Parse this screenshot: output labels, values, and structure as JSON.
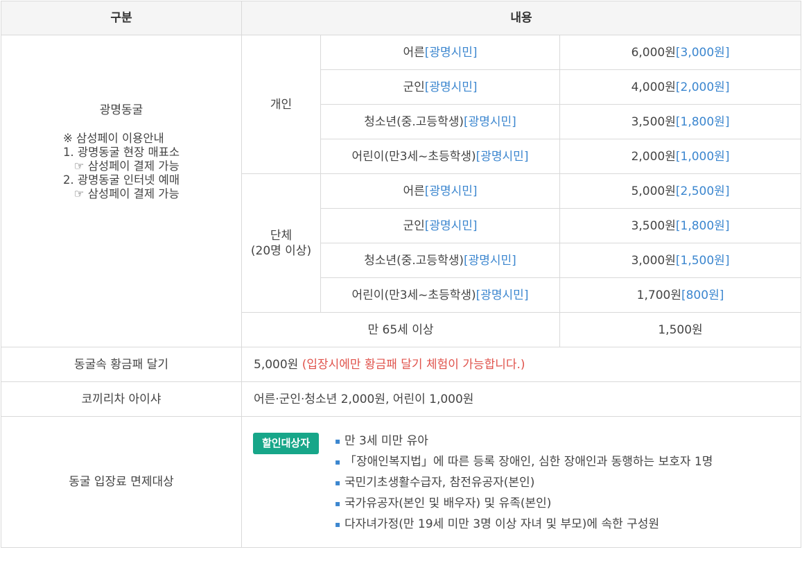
{
  "header": {
    "col1": "구분",
    "col2": "내용"
  },
  "cave": {
    "title": "광명동굴",
    "notes": [
      "※ 삼성페이 이용안내",
      "1. 광명동굴 현장 매표소",
      "   ☞ 삼성페이 결제 가능",
      "2. 광명동굴 인터넷 예매",
      "   ☞ 삼성페이 결제 가능"
    ],
    "individual_label": "개인",
    "group_label_1": "단체",
    "group_label_2": "(20명 이상)",
    "individual": [
      {
        "name": "어른",
        "tag": "[광명시민]",
        "price": "6,000원",
        "citizen_price": "[3,000원]"
      },
      {
        "name": "군인",
        "tag": "[광명시민]",
        "price": "4,000원",
        "citizen_price": "[2,000원]"
      },
      {
        "name": "청소년(중.고등학생)",
        "tag": "[광명시민]",
        "price": "3,500원",
        "citizen_price": "[1,800원]"
      },
      {
        "name": "어린이(만3세~초등학생)",
        "tag": "[광명시민]",
        "price": "2,000원",
        "citizen_price": "[1,000원]"
      }
    ],
    "group": [
      {
        "name": "어른",
        "tag": "[광명시민]",
        "price": "5,000원",
        "citizen_price": "[2,500원]"
      },
      {
        "name": "군인",
        "tag": "[광명시민]",
        "price": "3,500원",
        "citizen_price": "[1,800원]"
      },
      {
        "name": "청소년(중.고등학생)",
        "tag": "[광명시민]",
        "price": "3,000원",
        "citizen_price": "[1,500원]"
      },
      {
        "name": "어린이(만3세~초등학생)",
        "tag": "[광명시민]",
        "price": "1,700원",
        "citizen_price": "[800원]"
      }
    ],
    "senior": {
      "label": "만 65세 이상",
      "price": "1,500원"
    }
  },
  "gold": {
    "label": "동굴속 황금패 달기",
    "price": "5,000원 ",
    "note": "(입장시에만 황금패 달기 체험이 가능합니다.)"
  },
  "elephant": {
    "label": "코끼리차 아이샤",
    "value": "어른·군인·청소년 2,000원, 어린이 1,000원"
  },
  "exempt": {
    "label": "동굴 입장료 면제대상",
    "badge": "할인대상자",
    "items": [
      "만 3세 미만 유아",
      "「장애인복지법」에 따른 등록 장애인, 심한 장애인과 동행하는 보호자 1명",
      "국민기초생활수급자, 참전유공자(본인)",
      "국가유공자(본인 및 배우자) 및 유족(본인)",
      "다자녀가정(만 19세 미만 3명 이상 자녀 및 부모)에 속한 구성원"
    ]
  },
  "colors": {
    "accent": "#3b86cf",
    "warning": "#e0534c",
    "badge": "#17a689"
  },
  "icons": {
    "bullet": "bullet-dot-icon"
  }
}
